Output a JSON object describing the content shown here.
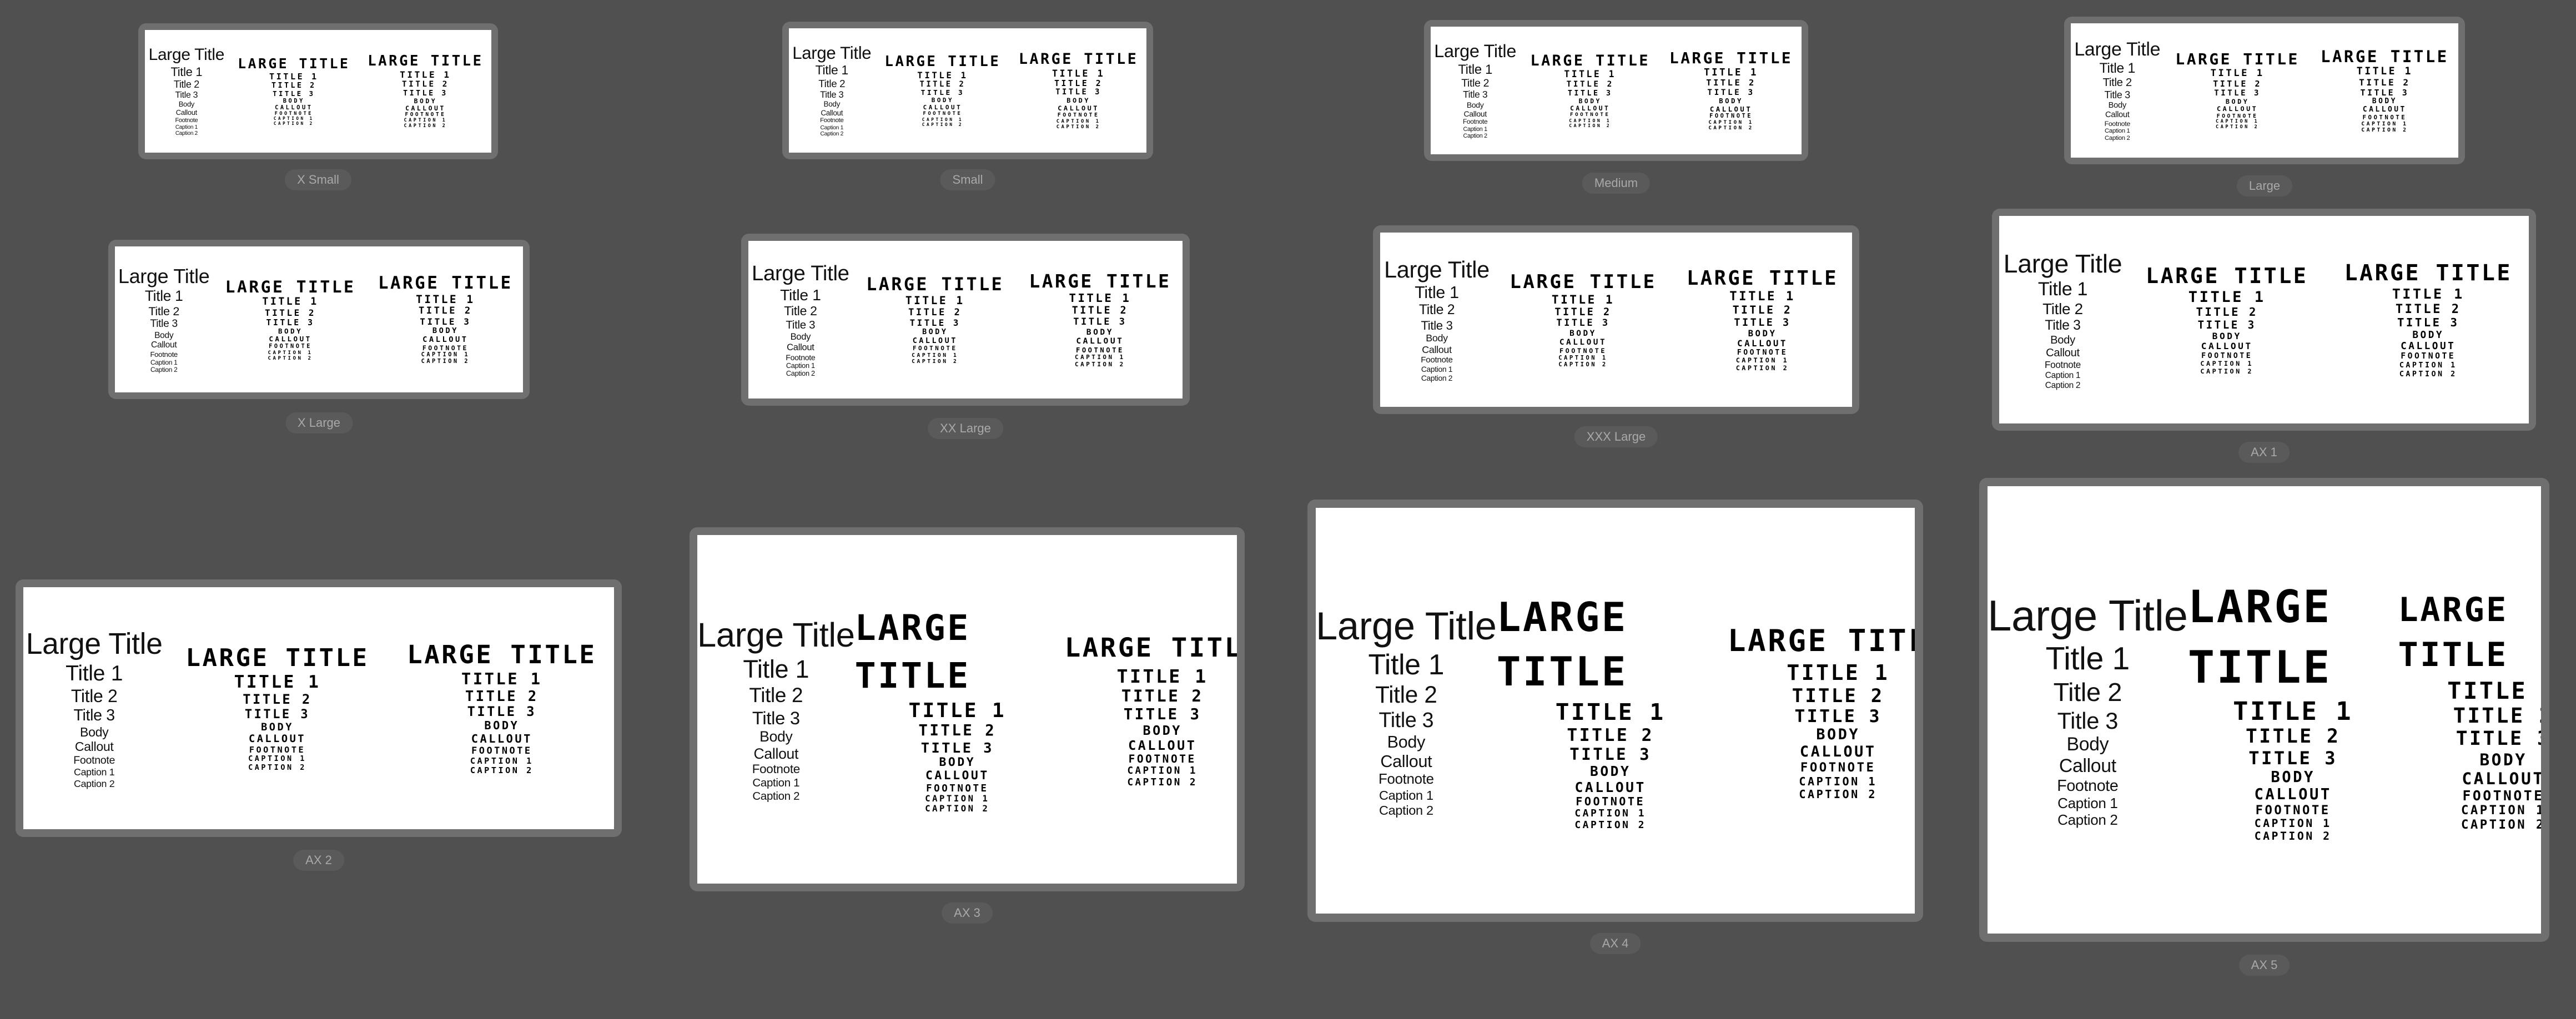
{
  "background_color": "#505050",
  "frame_color": "#6f6f6f",
  "styles_system": [
    "Large Title",
    "Title 1",
    "Title 2",
    "Title 3",
    "Body",
    "Callout",
    "Footnote",
    "Caption 1",
    "Caption 2"
  ],
  "styles_pixel": [
    "LARGE TITLE",
    "TITLE 1",
    "TITLE 2",
    "TITLE 3",
    "BODY",
    "CALLOUT",
    "FOOTNOTE",
    "CAPTION 1",
    "CAPTION 2"
  ],
  "previews": [
    {
      "label": "X Small"
    },
    {
      "label": "Small"
    },
    {
      "label": "Medium"
    },
    {
      "label": "Large"
    },
    {
      "label": "X Large"
    },
    {
      "label": "XX Large"
    },
    {
      "label": "XXX Large"
    },
    {
      "label": "AX 1"
    },
    {
      "label": "AX 2"
    },
    {
      "label": "AX 3"
    },
    {
      "label": "AX 4"
    },
    {
      "label": "AX 5"
    }
  ]
}
